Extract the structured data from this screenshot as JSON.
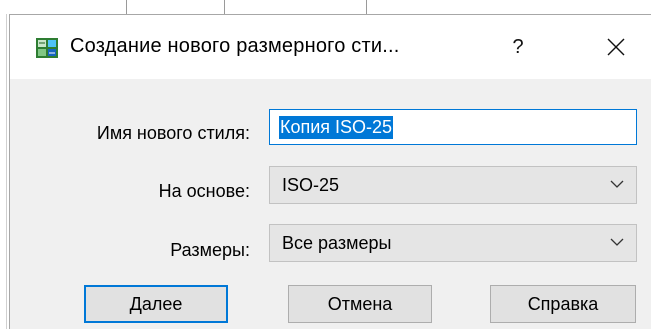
{
  "dialog": {
    "title": "Создание нового размерного сти...",
    "help_glyph": "?",
    "close_glyph": "✕",
    "icon": "dimension-style-icon"
  },
  "form": {
    "new_style_name_label": "Имя нового стиля:",
    "new_style_name_value": "Копия ISO-25",
    "based_on_label": "На основе:",
    "based_on_value": "ISO-25",
    "sizes_label": "Размеры:",
    "sizes_value": "Все размеры"
  },
  "buttons": {
    "next": "Далее",
    "cancel": "Отмена",
    "help": "Справка"
  },
  "colors": {
    "accent": "#0078d7",
    "dialog_bg": "#f0f0f0",
    "combo_bg": "#e5e5e5",
    "button_bg": "#e1e1e1"
  }
}
